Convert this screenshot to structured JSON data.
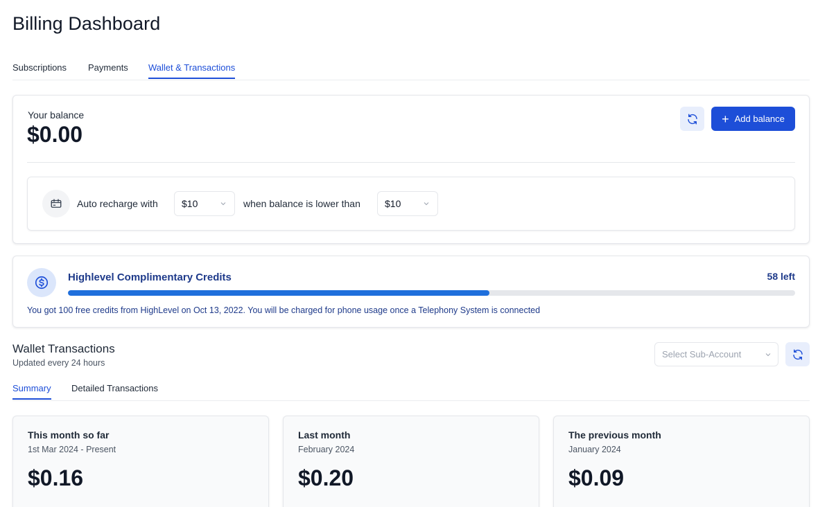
{
  "page": {
    "title": "Billing Dashboard"
  },
  "tabs": [
    {
      "label": "Subscriptions",
      "active": false
    },
    {
      "label": "Payments",
      "active": false
    },
    {
      "label": "Wallet & Transactions",
      "active": true
    }
  ],
  "balance": {
    "label": "Your balance",
    "value": "$0.00",
    "refresh_icon": "refresh-icon",
    "add_button_label": "Add balance"
  },
  "auto_recharge": {
    "icon": "wallet-card-icon",
    "prefix": "Auto recharge with",
    "amount": "$10",
    "middle": "when balance is lower than",
    "threshold": "$10"
  },
  "credits": {
    "icon": "dollar-circle-icon",
    "title": "Highlevel Complimentary Credits",
    "left_label": "58 left",
    "progress_percent": 58,
    "description": "You got 100 free credits from HighLevel on Oct 13, 2022. You will be charged for phone usage once a Telephony System is connected"
  },
  "wallet_transactions": {
    "title": "Wallet Transactions",
    "subtitle": "Updated every 24 hours",
    "sub_account_placeholder": "Select Sub-Account",
    "tabs": [
      {
        "label": "Summary",
        "active": true
      },
      {
        "label": "Detailed Transactions",
        "active": false
      }
    ],
    "months": [
      {
        "label": "This month so far",
        "range": "1st Mar 2024 - Present",
        "value": "$0.16"
      },
      {
        "label": "Last month",
        "range": "February 2024",
        "value": "$0.20"
      },
      {
        "label": "The previous month",
        "range": "January 2024",
        "value": "$0.09"
      }
    ]
  },
  "colors": {
    "accent": "#1d4ed8",
    "progress": "#1f6fdc",
    "credits_text": "#1e3a8a"
  }
}
